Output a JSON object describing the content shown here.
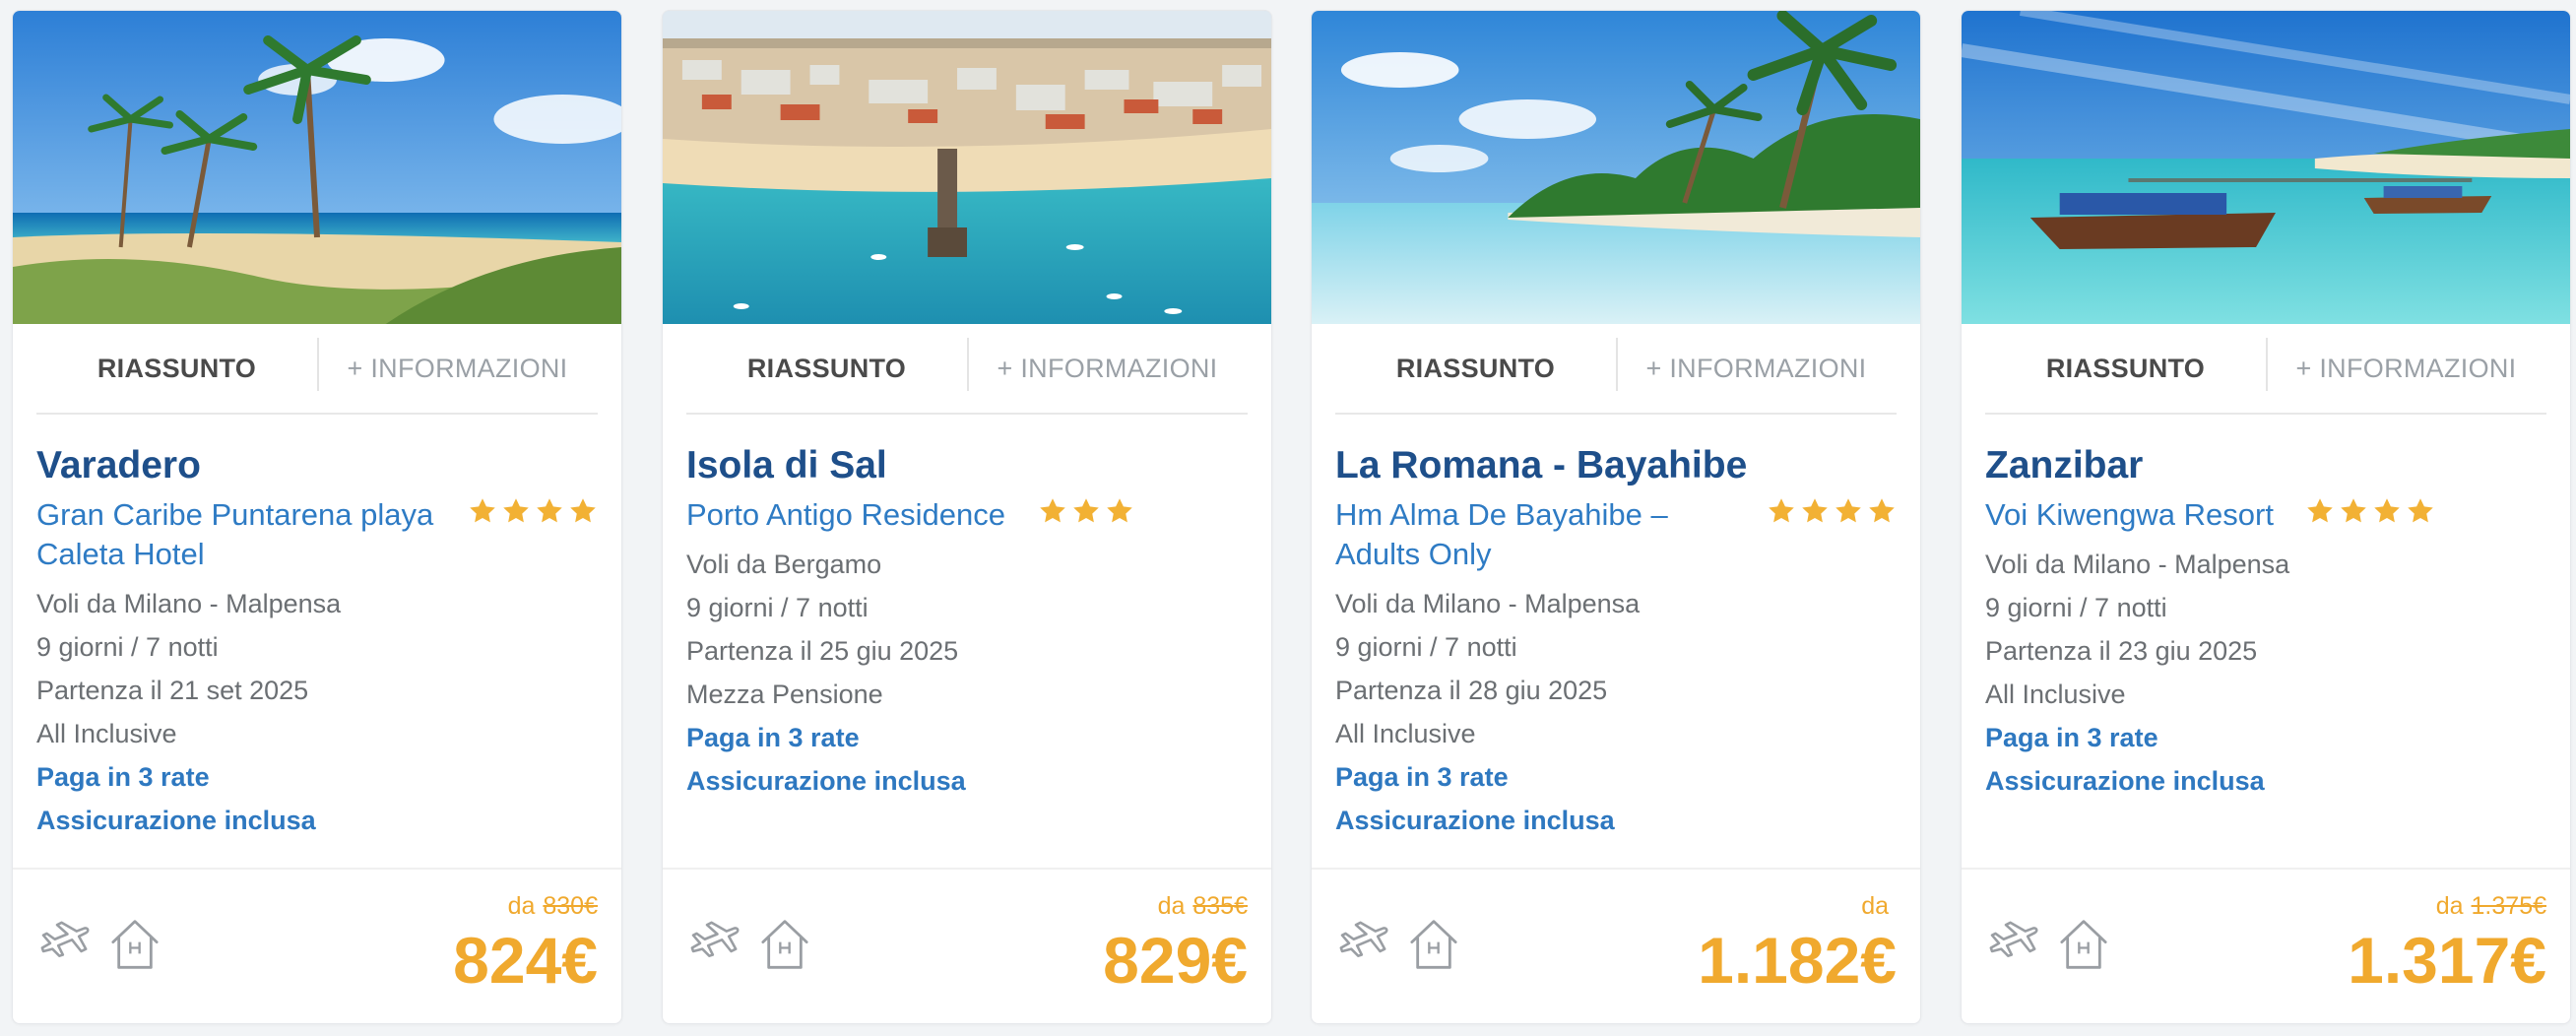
{
  "colors": {
    "title": "#1e4f8a",
    "link": "#2e7bc4",
    "price": "#f0a92e",
    "star": "#f2b134",
    "muted": "#6b6f73"
  },
  "tabs": {
    "summary": "RIASSUNTO",
    "more": "+ INFORMAZIONI"
  },
  "icons": [
    "plane-icon",
    "hotel-icon",
    "star-icon"
  ],
  "currency": "€",
  "cards": [
    {
      "destination": "Varadero",
      "hotel": "Gran Caribe Puntarena playa Caleta Hotel",
      "stars": 4,
      "details": [
        "Voli da Milano - Malpensa",
        "9 giorni / 7 notti",
        "Partenza il 21 set 2025",
        "All Inclusive"
      ],
      "extras": [
        "Paga in 3 rate",
        "Assicurazione inclusa"
      ],
      "from_label": "da",
      "old_price": "830€",
      "price": "824€"
    },
    {
      "destination": "Isola di Sal",
      "hotel": "Porto Antigo Residence",
      "stars": 3,
      "details": [
        "Voli da Bergamo",
        "9 giorni / 7 notti",
        "Partenza il 25 giu 2025",
        "Mezza Pensione"
      ],
      "extras": [
        "Paga in 3 rate",
        "Assicurazione inclusa"
      ],
      "from_label": "da",
      "old_price": "835€",
      "price": "829€"
    },
    {
      "destination": "La Romana - Bayahibe",
      "hotel": "Hm Alma De Bayahibe – Adults Only",
      "stars": 4,
      "details": [
        "Voli da Milano - Malpensa",
        "9 giorni / 7 notti",
        "Partenza il 28 giu 2025",
        "All Inclusive"
      ],
      "extras": [
        "Paga in 3 rate",
        "Assicurazione inclusa"
      ],
      "from_label": "da",
      "old_price": "",
      "price": "1.182€"
    },
    {
      "destination": "Zanzibar",
      "hotel": "Voi Kiwengwa Resort",
      "stars": 4,
      "details": [
        "Voli da Milano - Malpensa",
        "9 giorni / 7 notti",
        "Partenza il 23 giu 2025",
        "All Inclusive"
      ],
      "extras": [
        "Paga in 3 rate",
        "Assicurazione inclusa"
      ],
      "from_label": "da",
      "old_price": "1.375€",
      "price": "1.317€"
    }
  ]
}
